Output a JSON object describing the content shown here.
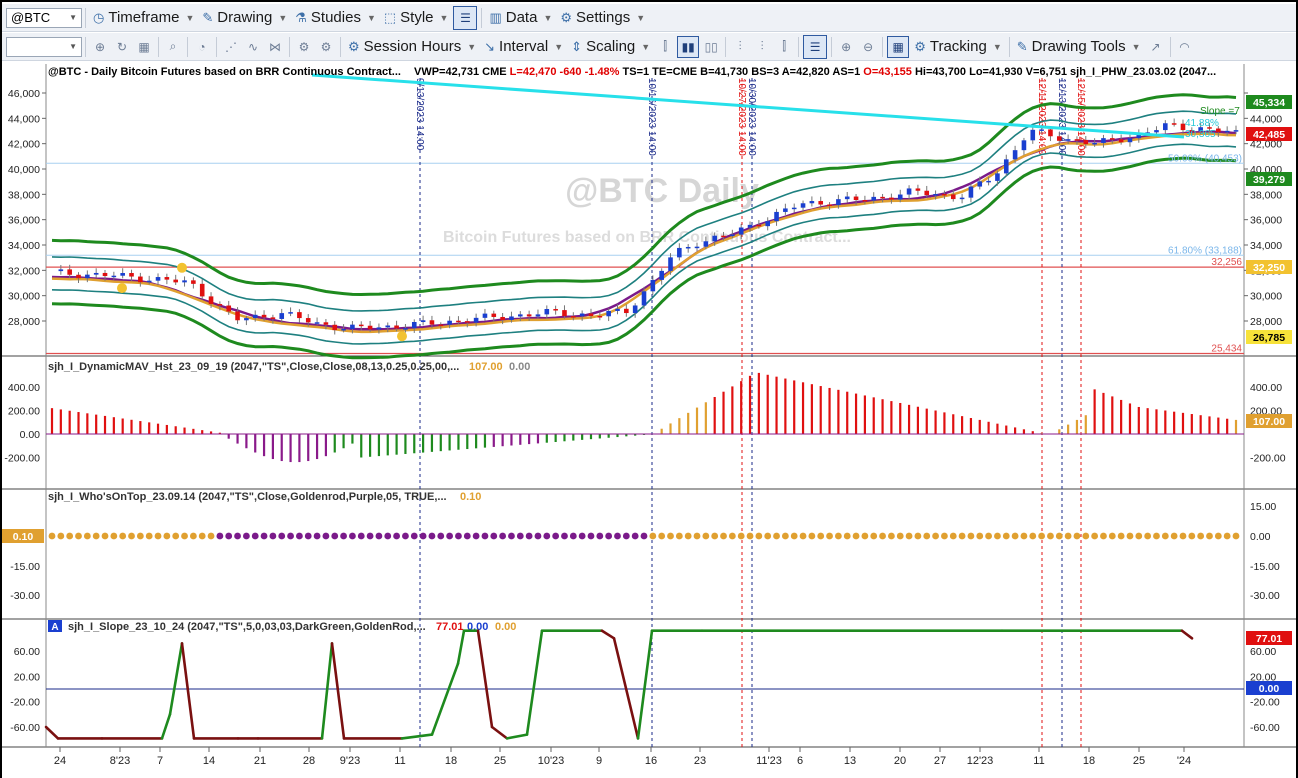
{
  "toolbar1": {
    "symbol": "@BTC",
    "timeframe": "Timeframe",
    "drawing": "Drawing",
    "studies": "Studies",
    "style": "Style",
    "data": "Data",
    "settings": "Settings"
  },
  "toolbar2": {
    "session_hours": "Session Hours",
    "interval": "Interval",
    "scaling": "Scaling",
    "tracking": "Tracking",
    "drawing_tools": "Drawing Tools"
  },
  "main": {
    "header": "@BTC - Daily  Bitcoin Futures based on BRR Continuous Contract...",
    "quotes": [
      {
        "text": "VWP=42,731",
        "color": "#000000"
      },
      {
        "text": "CME",
        "color": "#000000"
      },
      {
        "text": "L=42,470",
        "color": "#e00000"
      },
      {
        "text": "-640",
        "color": "#e00000"
      },
      {
        "text": "-1.48%",
        "color": "#e00000"
      },
      {
        "text": "TS=1",
        "color": "#000000"
      },
      {
        "text": "TE=CME",
        "color": "#000000"
      },
      {
        "text": "B=41,730",
        "color": "#000000"
      },
      {
        "text": "BS=3",
        "color": "#000000"
      },
      {
        "text": "A=42,820",
        "color": "#000000"
      },
      {
        "text": "AS=1",
        "color": "#000000"
      },
      {
        "text": "O=43,155",
        "color": "#e00000"
      },
      {
        "text": "Hi=43,700",
        "color": "#000000"
      },
      {
        "text": "Lo=41,930",
        "color": "#000000"
      },
      {
        "text": "V=6,751",
        "color": "#000000"
      },
      {
        "text": "sjh_I_PHW_23.03.02 (2047...",
        "color": "#000000"
      }
    ],
    "watermark_title": "@BTC Daily",
    "watermark_sub": "Bitcoin Futures based on BRR Continuous Contract...",
    "y_ticks": [
      "46,000",
      "44,000",
      "42,000",
      "40,000",
      "38,000",
      "36,000",
      "34,000",
      "32,000",
      "30,000",
      "28,000"
    ],
    "date_markers": [
      "9/13/2023 14:00",
      "10/16/2023 14:00",
      "10/27/2023 14:00",
      "10/30/2023 14:00",
      "12/11/2023 14:00",
      "12/13/2023 14:00",
      "12/15/2023 14:00"
    ],
    "fib_labels": [
      {
        "text": "50.00% (40,453)",
        "color": "#7ab6ea"
      },
      {
        "text": "61.80% (33,188)",
        "color": "#7ab6ea"
      },
      {
        "text": "32,256",
        "color": "#e05050"
      },
      {
        "text": "25,434",
        "color": "#e05050"
      }
    ],
    "slope_label": "Slope =7",
    "pct_label": "41.88%",
    "level_label": "30,365",
    "badges": [
      {
        "text": "45,334",
        "bg": "#1e8a1e",
        "fg": "#ffffff"
      },
      {
        "text": "42,485",
        "bg": "#e01010",
        "fg": "#ffffff"
      },
      {
        "text": "39,279",
        "bg": "#1e8a1e",
        "fg": "#ffffff"
      },
      {
        "text": "32,250",
        "bg": "#f2c230",
        "fg": "#ffffff"
      },
      {
        "text": "26,785",
        "bg": "#f7e23a",
        "fg": "#000000"
      }
    ]
  },
  "panel_histogram": {
    "label": "sjh_I_DynamicMAV_Hst_23_09_19 (2047,\"TS\",Close,Close,08,13,0.25,0.25,00,...",
    "v1": "107.00",
    "v2": "0.00",
    "y_ticks": [
      "400.00",
      "200.00",
      "0.00",
      "-200.00"
    ],
    "badge": "107.00"
  },
  "panel_whosontop": {
    "label": "sjh_I_Who'sOnTop_23.09.14 (2047,\"TS\",Close,Goldenrod,Purple,05,  TRUE,...",
    "v1": "0.10",
    "y_ticks": [
      "15.00",
      "0.00",
      "-15.00",
      "-30.00"
    ],
    "badge": "0.10"
  },
  "panel_slope": {
    "icon": "A",
    "label": "sjh_I_Slope_23_10_24 (2047,\"TS\",5,0,03,03,DarkGreen,GoldenRod,...",
    "v1": "77.01",
    "v2": "0.00",
    "v3": "0.00",
    "y_ticks": [
      "60.00",
      "20.00",
      "-20.00",
      "-60.00"
    ],
    "badge1": "77.01",
    "badge2": "0.00"
  },
  "x_axis": [
    "24",
    "8'23",
    "7",
    "14",
    "21",
    "28",
    "9'23",
    "11",
    "18",
    "25",
    "10'23",
    "9",
    "16",
    "23",
    "11'23",
    "6",
    "13",
    "20",
    "27",
    "12'23",
    "11",
    "18",
    "25",
    "'24"
  ],
  "colors": {
    "up_candle": "#1a3fd0",
    "down_candle": "#e01010",
    "band_outer": "#1e8a1e",
    "band_inner": "#1e8080",
    "ma_gold": "#e0a030",
    "ma_purple": "#7a1a8a",
    "trendline": "#27e0ea",
    "hist_pos_red": "#e01010",
    "hist_pos_gold": "#e0a030",
    "hist_neg_green": "#1e8a1e",
    "hist_neg_purple": "#8a1a8a",
    "slope_green": "#1e8a1e",
    "slope_dark": "#7a1010"
  }
}
